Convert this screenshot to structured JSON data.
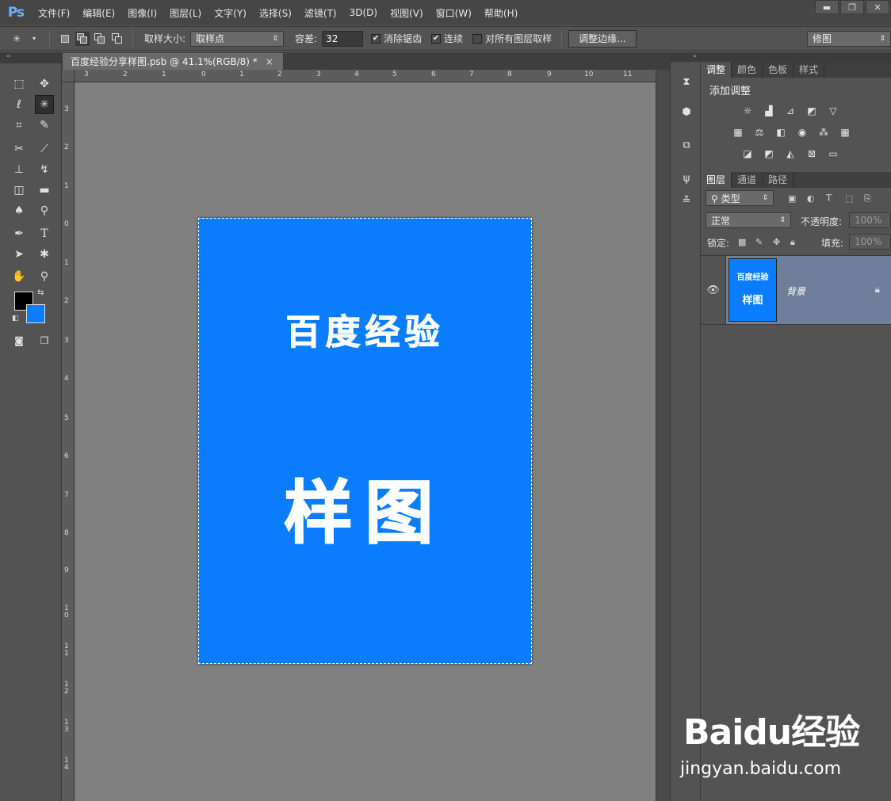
{
  "app": {
    "logo": "Ps"
  },
  "menu": [
    "文件(F)",
    "编辑(E)",
    "图像(I)",
    "图层(L)",
    "文字(Y)",
    "选择(S)",
    "滤镜(T)",
    "3D(D)",
    "视图(V)",
    "窗口(W)",
    "帮助(H)"
  ],
  "window_controls": {
    "minimize": "▬",
    "restore": "❐",
    "close": "✕"
  },
  "options": {
    "sample_size_label": "取样大小:",
    "sample_size_value": "取样点",
    "tolerance_label": "容差:",
    "tolerance_value": "32",
    "anti_alias_label": "消除锯齿",
    "anti_alias_checked": true,
    "contiguous_label": "连续",
    "contiguous_checked": true,
    "all_layers_label": "对所有图层取样",
    "all_layers_checked": false,
    "refine_edge_label": "调整边缘...",
    "workspace_value": "修图"
  },
  "document": {
    "tab_title": "百度经验分享样图.psb @ 41.1%(RGB/8) *",
    "tab_close": "×",
    "canvas_title": "百度经验",
    "canvas_sample": "样图",
    "canvas_color": "#0a7dff"
  },
  "rulers": {
    "top": [
      "3",
      "2",
      "1",
      "0",
      "1",
      "2",
      "3",
      "4",
      "5",
      "6",
      "7",
      "8",
      "9",
      "10",
      "11"
    ],
    "left": [
      "3",
      "2",
      "1",
      "0",
      "1",
      "2",
      "3",
      "4",
      "5",
      "6",
      "7",
      "8",
      "9",
      "1 0",
      "1 1",
      "1 2",
      "1 3",
      "1 4"
    ]
  },
  "colors": {
    "foreground": "#000000",
    "background": "#0a7dff"
  },
  "adjustments": {
    "tabs": [
      "调整",
      "颜色",
      "色板",
      "样式"
    ],
    "title": "添加调整"
  },
  "layers": {
    "tabs": [
      "图层",
      "通道",
      "路径"
    ],
    "filter_value": "类型",
    "blend_mode": "正常",
    "opacity_label": "不透明度:",
    "opacity_value": "100%",
    "lock_label": "锁定:",
    "fill_label": "填充:",
    "fill_value": "100%",
    "items": [
      {
        "name": "背景",
        "thumb_title": "百度经验",
        "thumb_sample": "样图",
        "visible": true,
        "locked": true
      }
    ]
  },
  "watermark": {
    "brand": "Baidu经验",
    "url": "jingyan.baidu.com"
  }
}
